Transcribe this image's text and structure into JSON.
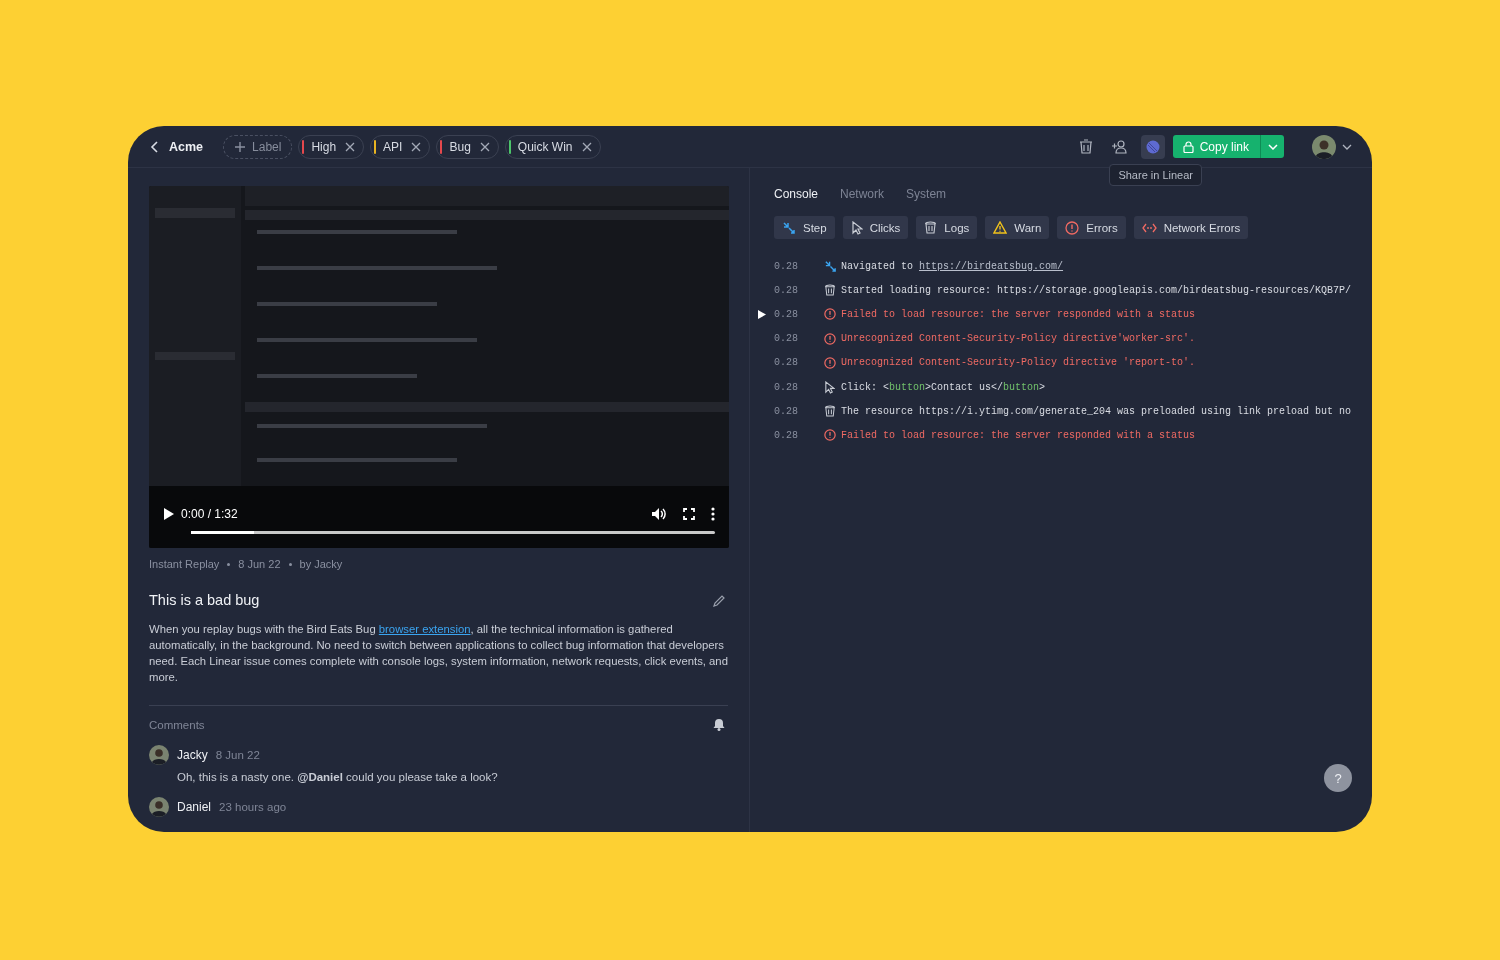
{
  "header": {
    "back_label": "Acme",
    "add_label": "Label",
    "tags": [
      {
        "label": "High",
        "color": "#e5484d"
      },
      {
        "label": "API",
        "color": "#e8b422"
      },
      {
        "label": "Bug",
        "color": "#e5484d"
      },
      {
        "label": "Quick Win",
        "color": "#4cc46a"
      }
    ],
    "tooltip": "Share in Linear",
    "copy_button": "Copy link"
  },
  "video": {
    "time": "0:00 / 1:32",
    "level": 0.12
  },
  "meta": [
    "Instant Replay",
    "8 Jun 22",
    "by Jacky"
  ],
  "issue": {
    "title": "This is a bad bug",
    "before": "When you replay bugs with the Bird Eats Bug ",
    "link": "browser extension",
    "after": ", all the technical information is gathered automatically, in the background. No need to switch between applications to collect bug information that developers need. Each Linear issue comes complete with console logs, system information, network requests, click events, and more."
  },
  "comments": {
    "title": "Comments",
    "items": [
      {
        "author": "Jacky",
        "time": "8 Jun 22",
        "text": "Oh, this is a nasty one. **@Daniel** could you please take a look?"
      },
      {
        "author": "Daniel",
        "time": "23 hours ago"
      }
    ]
  },
  "console": {
    "tabs": [
      {
        "label": "Console",
        "selected": true
      },
      {
        "label": "Network",
        "selected": false
      },
      {
        "label": "System",
        "selected": false
      }
    ],
    "filters": [
      {
        "kind": "step",
        "label": "Step"
      },
      {
        "kind": "click",
        "label": "Clicks"
      },
      {
        "kind": "log",
        "label": "Logs"
      },
      {
        "kind": "warn",
        "label": "Warn"
      },
      {
        "kind": "error",
        "label": "Errors"
      },
      {
        "kind": "network",
        "label": "Network Errors"
      }
    ],
    "rows": [
      {
        "time": "0.28",
        "kind": "step",
        "expandable": false,
        "parts": [
          {
            "kind": "plain",
            "text": "Navigated to "
          },
          {
            "kind": "link",
            "text": "https://birdeatsbug.com/"
          }
        ]
      },
      {
        "time": "0.28",
        "kind": "log",
        "expandable": false,
        "parts": [
          {
            "kind": "plain",
            "text": "Started loading resource: https://storage.googleapis.com/birdeatsbug-resources/KQB7P/"
          }
        ]
      },
      {
        "time": "0.28",
        "kind": "error",
        "expandable": true,
        "parts": [
          {
            "kind": "plain",
            "text": "Failed to load resource: the server responded with a status"
          }
        ]
      },
      {
        "time": "0.28",
        "kind": "error",
        "expandable": false,
        "parts": [
          {
            "kind": "plain",
            "text": "Unrecognized Content-Security-Policy directive'worker-src'."
          }
        ]
      },
      {
        "time": "0.28",
        "kind": "error",
        "expandable": false,
        "parts": [
          {
            "kind": "plain",
            "text": "Unrecognized Content-Security-Policy directive 'report-to'."
          }
        ]
      },
      {
        "time": "0.28",
        "kind": "click",
        "expandable": false,
        "parts": [
          {
            "kind": "plain",
            "text": "Click: <"
          },
          {
            "kind": "tag",
            "text": "button"
          },
          {
            "kind": "plain",
            "text": ">Contact us</"
          },
          {
            "kind": "tag",
            "text": "button"
          },
          {
            "kind": "plain",
            "text": ">"
          }
        ]
      },
      {
        "time": "0.28",
        "kind": "log",
        "expandable": false,
        "parts": [
          {
            "kind": "plain",
            "text": "The resource https://i.ytimg.com/generate_204 was preloaded using link preload but no"
          }
        ]
      },
      {
        "time": "0.28",
        "kind": "error",
        "expandable": false,
        "parts": [
          {
            "kind": "plain",
            "text": "Failed to load resource: the server responded with a status"
          }
        ]
      }
    ]
  },
  "help": "?"
}
